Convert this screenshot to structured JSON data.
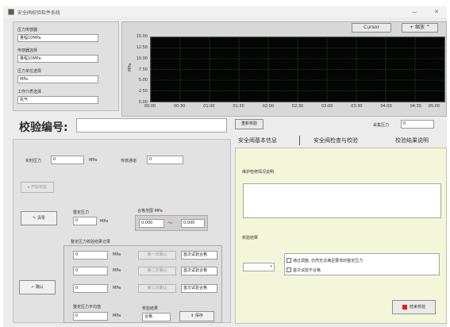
{
  "window": {
    "title": "安全阀校验软件系统",
    "minimize": "—",
    "close": "✕"
  },
  "config": {
    "pressure_sensor_label": "压力传感器",
    "pressure_sensor_value": "量程10MPa",
    "sensor_range_label": "传感器选择",
    "sensor_range_value": "量程10MPa",
    "unit_label": "压力单位选择",
    "unit_value": "MPa",
    "medium_label": "工作介质选择",
    "medium_value": "氮气"
  },
  "graph": {
    "cursor_button": "Cursor",
    "zoom_button": "+ 缩放 ^",
    "y_axis_label": "MPa"
  },
  "chart_data": {
    "type": "line",
    "xlabel": "",
    "ylabel": "MPa",
    "ylim": [
      0,
      15
    ],
    "y_ticks": [
      "15.00",
      "12.50",
      "10.00",
      "7.50",
      "5.00",
      "2.50",
      "0.00"
    ],
    "x_ticks": [
      "00:00",
      "00:30",
      "01:00",
      "01:30",
      "02:00",
      "02:30",
      "03:00",
      "03:30",
      "04:00",
      "04:30",
      "05:00"
    ],
    "grid": true,
    "series": []
  },
  "calibration": {
    "title": "校验编号:",
    "number_value": ""
  },
  "left": {
    "realtime_label": "实时压力",
    "realtime_value": "0",
    "realtime_unit": "MPa",
    "channel_label": "传感通道",
    "channel_value": "0",
    "disabled_button": "开始校验",
    "clear_button": "清零",
    "set_pressure_label": "整定压力",
    "set_pressure_value": "0",
    "set_pressure_unit": "MPa",
    "tolerance_label": "合格范围",
    "tolerance_unit": "MPa",
    "tolerance_low": "0.000",
    "tolerance_high": "0.000",
    "record_title": "整定压力校验结果记录",
    "rows": [
      {
        "value": "0",
        "unit": "MPa",
        "action": "第一次确认",
        "result": "首次试验合格"
      },
      {
        "value": "0",
        "unit": "MPa",
        "action": "第二次确认",
        "result": "首次试验合格"
      },
      {
        "value": "0",
        "unit": "MPa",
        "action": "第三次确认",
        "result": "首次试验合格"
      }
    ],
    "confirm_button": "确认",
    "avg_label": "整定压力平均值",
    "avg_value": "0",
    "avg_unit": "MPa",
    "result_label": "校验结果",
    "result_value": "合格",
    "save_button": "保存"
  },
  "right": {
    "reset_button": "重新校验",
    "recording_label": "采集压力",
    "recording_value": "0",
    "tabs": [
      "安全阀基本信息",
      "安全阀检查与校验",
      "校验结果说明"
    ],
    "desc_label": "维护检修情况说明",
    "result_label": "校验结果",
    "check1": "通过调整, 仍然无法满足要求的整定压力",
    "check2": "首次试验不合格",
    "stop_button": "结束校验"
  }
}
